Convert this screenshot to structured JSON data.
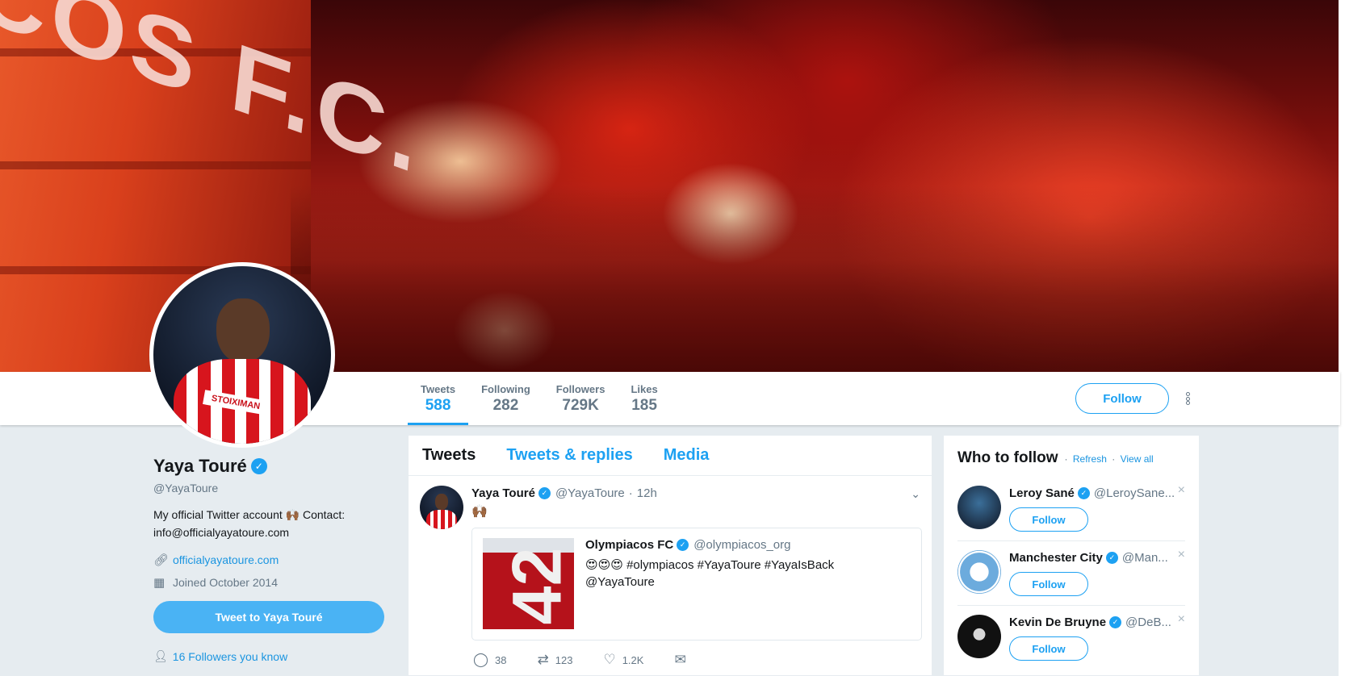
{
  "banner": {
    "club_text": "COS F.C."
  },
  "stats": [
    {
      "label": "Tweets",
      "value": "588"
    },
    {
      "label": "Following",
      "value": "282"
    },
    {
      "label": "Followers",
      "value": "729K"
    },
    {
      "label": "Likes",
      "value": "185"
    }
  ],
  "follow_label": "Follow",
  "profile": {
    "name": "Yaya Touré",
    "handle": "@YayaToure",
    "bio": "My official Twitter account 🙌🏾 Contact: info@officialyayatoure.com",
    "website": "officialyayatoure.com",
    "joined": "Joined October 2014",
    "tweet_to_label": "Tweet to Yaya Touré",
    "followers_you_know": "16 Followers you know",
    "avatar_sponsor": "STOIXIMAN"
  },
  "timeline": {
    "tabs": [
      "Tweets",
      "Tweets & replies",
      "Media"
    ],
    "tweet": {
      "name": "Yaya Touré",
      "handle": "@YayaToure",
      "dot": "·",
      "time": "12h",
      "text": "🙌🏾",
      "quote": {
        "name": "Olympiacos FC",
        "handle": "@olympiacos_org",
        "text_line1": "😍😍😍 #olympiacos #YayaToure #YayaIsBack",
        "text_line2": "@YayaToure",
        "image_number": "42"
      },
      "replies": "38",
      "retweets": "123",
      "likes": "1.2K"
    }
  },
  "who_to_follow": {
    "title": "Who to follow",
    "refresh": "Refresh",
    "sep": "·",
    "view_all": "View all",
    "items": [
      {
        "name": "Leroy Sané",
        "handle": "@LeroySane...",
        "follow": "Follow"
      },
      {
        "name": "Manchester City",
        "handle": "@Man...",
        "follow": "Follow"
      },
      {
        "name": "Kevin De Bruyne",
        "handle": "@DeB...",
        "follow": "Follow"
      }
    ]
  },
  "colors": {
    "accent": "#1da1f2",
    "background": "#e6ecf0",
    "muted": "#657786"
  }
}
